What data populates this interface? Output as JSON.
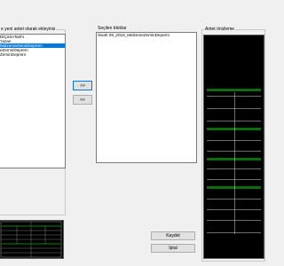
{
  "left_panel": {
    "title": "e yeni antet olarak ekleyiniz",
    "items": [
      {
        "label": "DlÇizimTarihi",
        "selected": false
      },
      {
        "label": "'razan",
        "selected": false
      },
      {
        "label": "MalzemeZeminDeprem",
        "selected": true
      },
      {
        "label": "eZeminDeprem",
        "selected": false
      },
      {
        "label": "ZeminDeprem",
        "selected": false
      }
    ]
  },
  "move_buttons": {
    "add_label": ">>",
    "remove_label": "<<"
  },
  "selected_panel": {
    "title": "Seçilen bloklar",
    "items": [
      {
        "label": "Sivah 09_2018_MalzemeZeminDeprem",
        "selected": false
      }
    ]
  },
  "preview_panel": {
    "title": "Antet önizleme"
  },
  "actions": {
    "save_label": "Kaydet",
    "cancel_label": "İptal"
  },
  "colors": {
    "selection": "#0078d7",
    "preview_background": "#000000",
    "table_header": "#0b6d0b"
  }
}
